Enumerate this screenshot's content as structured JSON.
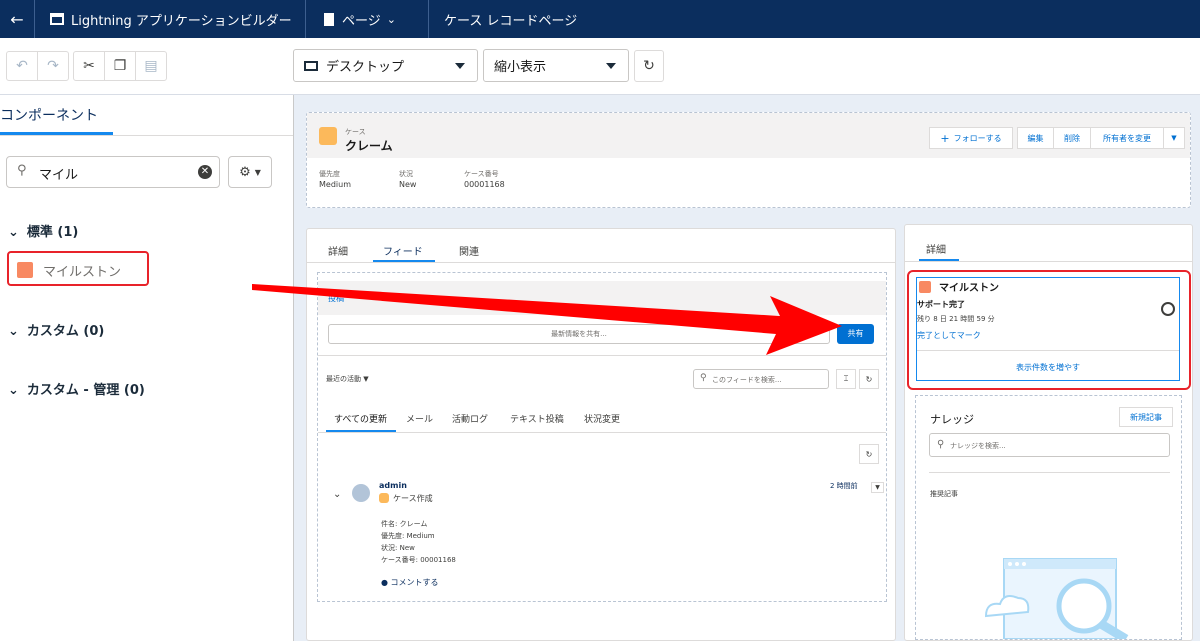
{
  "topbar": {
    "back": "←",
    "app_title": "Lightning アプリケーションビルダー",
    "page_menu": "ページ",
    "page_name": "ケース レコードページ"
  },
  "toolbar": {
    "device_select": "デスクトップ",
    "zoom_select": "縮小表示"
  },
  "left": {
    "tab": "コンポーネント",
    "search_value": "マイル",
    "sections": [
      {
        "label": "標準 (1)"
      },
      {
        "label": "カスタム (0)"
      },
      {
        "label": "カスタム - 管理 (0)"
      }
    ],
    "component": "マイルストン"
  },
  "header": {
    "object_label": "ケース",
    "record_name": "クレーム",
    "follow": "フォローする",
    "edit": "編集",
    "delete": "削除",
    "change_owner": "所有者を変更",
    "fields": [
      {
        "label": "優先度",
        "value": "Medium"
      },
      {
        "label": "状況",
        "value": "New"
      },
      {
        "label": "ケース番号",
        "value": "00001168"
      }
    ]
  },
  "main": {
    "tabs": [
      "詳細",
      "フィード",
      "関連"
    ],
    "post_tab": "投稿",
    "post_placeholder": "最新情報を共有...",
    "share": "共有",
    "recent": "最近の活動",
    "feed_search": "このフィードを検索...",
    "filters": [
      "すべての更新",
      "メール",
      "活動ログ",
      "テキスト投稿",
      "状況変更"
    ],
    "feed_item": {
      "user": "admin",
      "action": "ケース作成",
      "time": "2 時間前",
      "lines": [
        "件名: クレーム",
        "優先度: Medium",
        "状況: New",
        "ケース番号: 00001168"
      ],
      "comment": "コメントする"
    }
  },
  "right": {
    "tab": "詳細",
    "milestone": {
      "title": "マイルストン",
      "name": "サポート完了",
      "remaining": "残り 8 日 21 時間 59 分",
      "mark": "完了としてマーク",
      "more": "表示件数を増やす"
    },
    "knowledge": {
      "title": "ナレッジ",
      "new": "新規記事",
      "search": "ナレッジを検索...",
      "recommended": "推奨記事"
    }
  },
  "colors": {
    "topbar": "#0b2e5e",
    "accent": "#0070d2",
    "highlight": "#e8232a",
    "arrow": "#ff0000"
  }
}
